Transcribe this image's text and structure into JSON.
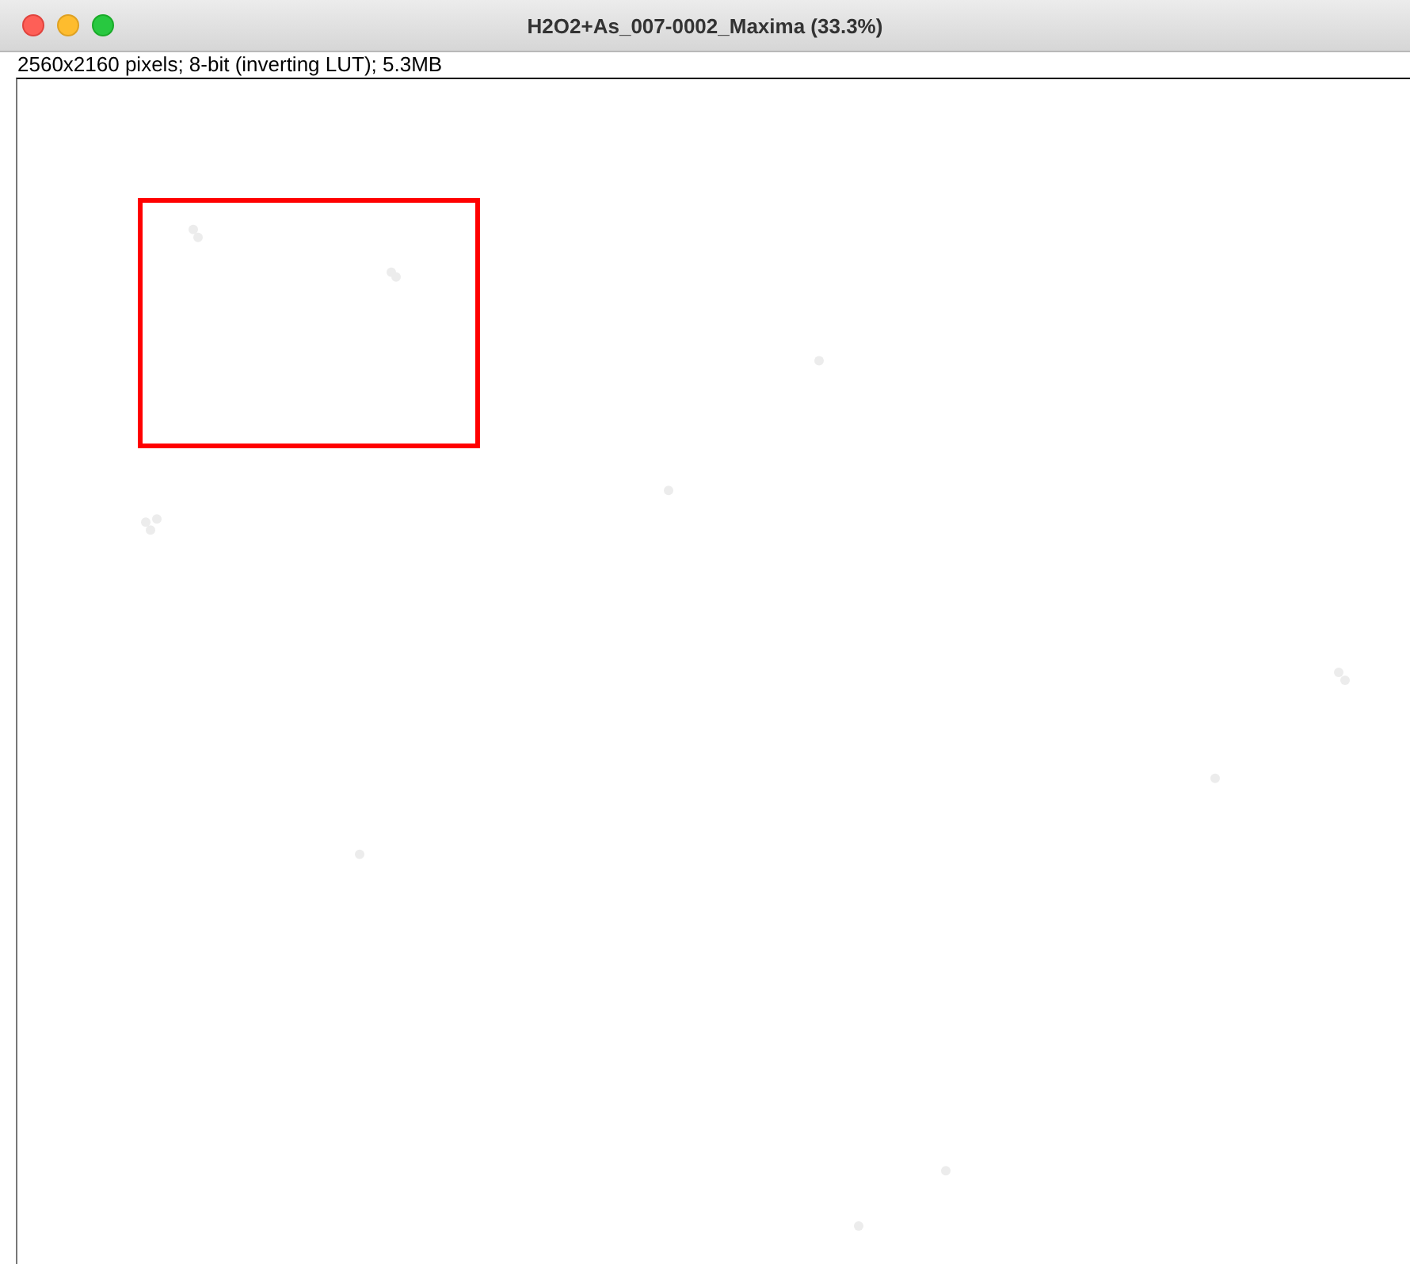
{
  "window": {
    "title": "H2O2+As_007-0002_Maxima (33.3%)"
  },
  "info": "2560x2160 pixels; 8-bit (inverting LUT); 5.3MB",
  "image": {
    "kind": "picture",
    "has_selection": true
  }
}
